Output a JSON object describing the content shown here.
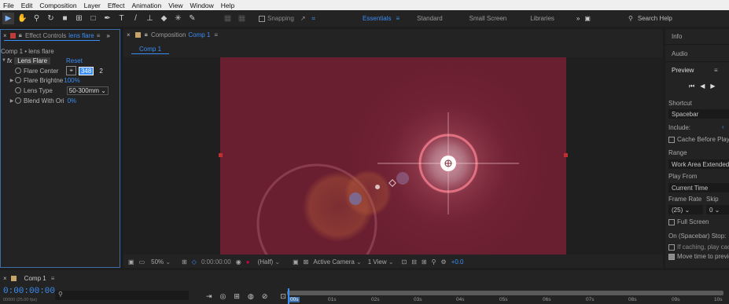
{
  "menu": [
    "File",
    "Edit",
    "Composition",
    "Layer",
    "Effect",
    "Animation",
    "View",
    "Window",
    "Help"
  ],
  "toolbar": {
    "snapping_label": "Snapping",
    "workspaces": [
      "Essentials",
      "Standard",
      "Small Screen",
      "Libraries"
    ],
    "active_workspace": "Essentials",
    "search_placeholder": "Search Help"
  },
  "effect_controls": {
    "tab_label": "Effect Controls",
    "tab_target": "lens flare",
    "breadcrumb": "Comp 1 • lens flare",
    "effect_badge": "fx",
    "effect_name": "Lens Flare",
    "reset_label": "Reset",
    "props": [
      {
        "name": "Flare Center",
        "value": "348",
        "value2": "2"
      },
      {
        "name": "Flare Brightne",
        "value": "100",
        "unit": "%"
      },
      {
        "name": "Lens Type",
        "value": "50-300mm"
      },
      {
        "name": "Blend With Ori",
        "value": "0",
        "unit": "%"
      }
    ]
  },
  "composition": {
    "panel_label": "Composition",
    "panel_target": "Comp 1",
    "tab": "Comp 1",
    "footer": {
      "zoom": "50%",
      "timecode": "0:00:00:00",
      "resolution": "(Half)",
      "camera": "Active Camera",
      "views": "1 View",
      "exposure": "+0.0"
    }
  },
  "right_panel": {
    "info": "Info",
    "audio": "Audio",
    "preview": "Preview",
    "shortcut_label": "Shortcut",
    "shortcut_value": "Spacebar",
    "include_label": "Include:",
    "cache_label": "Cache Before Play",
    "range_label": "Range",
    "range_value": "Work Area Extended",
    "play_from_label": "Play From",
    "play_from_value": "Current Time",
    "frame_rate_label": "Frame Rate",
    "skip_label": "Skip",
    "frame_rate_value": "(25)",
    "skip_value": "0",
    "full_screen_label": "Full Screen",
    "stop_label": "On (Spacebar) Stop:",
    "if_caching_label": "If caching, play cached",
    "move_time_label": "Move time to preview"
  },
  "timeline": {
    "tab_label": "Comp 1",
    "timecode": "0:00:00:00",
    "fps": "00000 (25.00 fps)",
    "ruler_labels": [
      "00s",
      "01s",
      "02s",
      "03s",
      "04s",
      "05s",
      "06s",
      "07s",
      "08s",
      "09s",
      "10s"
    ]
  },
  "colors": {
    "accent": "#3b8ef6",
    "canvas": "#6a1f30",
    "panel_bg": "#232323"
  }
}
